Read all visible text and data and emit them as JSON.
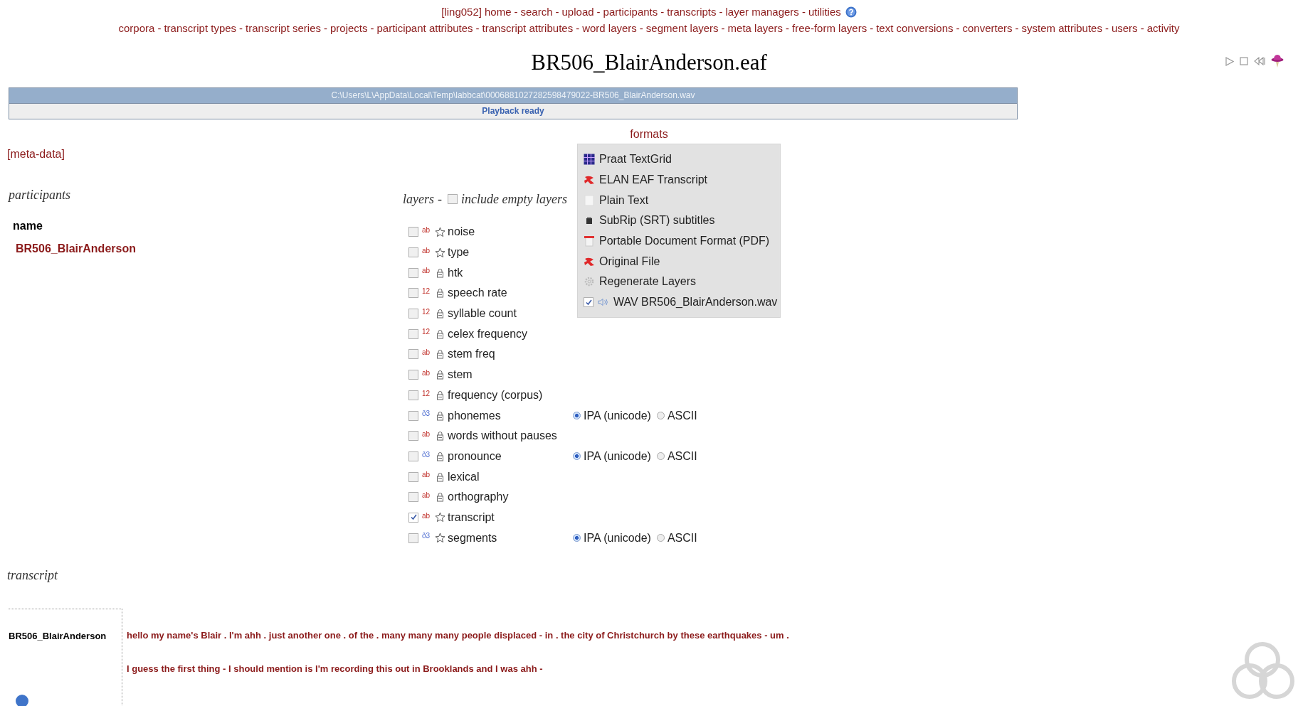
{
  "nav": {
    "user": "[ling052]",
    "separator": "-",
    "primary": [
      "home",
      "search",
      "upload",
      "participants",
      "transcripts",
      "layer managers",
      "utilities"
    ],
    "secondary": [
      "corpora",
      "transcript types",
      "transcript series",
      "projects",
      "participant attributes",
      "transcript attributes",
      "word layers",
      "segment layers",
      "meta layers",
      "free-form layers",
      "text conversions",
      "converters",
      "system attributes",
      "users",
      "activity"
    ]
  },
  "title": "BR506_BlairAnderson.eaf",
  "player": {
    "file": "C:\\Users\\L\\AppData\\Local\\Temp\\labbcat\\00068810272825984790​22-BR506_BlairAnderson.wav",
    "status": "Playback ready"
  },
  "formats": {
    "label": "formats",
    "items": [
      {
        "kind": "grid",
        "label": "Praat TextGrid"
      },
      {
        "kind": "elan",
        "label": "ELAN EAF Transcript"
      },
      {
        "kind": "blank",
        "label": "Plain Text"
      },
      {
        "kind": "srt",
        "label": "SubRip (SRT) subtitles"
      },
      {
        "kind": "pdf",
        "label": "Portable Document Format (PDF)"
      },
      {
        "kind": "elan",
        "label": "Original File"
      },
      {
        "kind": "gear",
        "label": "Regenerate Layers"
      },
      {
        "kind": "media",
        "label": "WAV BR506_BlairAnderson.wav",
        "checked": true
      }
    ]
  },
  "meta_data_link": "[meta-data]",
  "participants": {
    "heading": "participants",
    "column": "name",
    "rows": [
      "BR506_BlairAnderson"
    ]
  },
  "layers": {
    "heading": "layers",
    "separator": "-",
    "include_empty": {
      "label": "include empty layers",
      "checked": false
    },
    "items": [
      {
        "name": "noise",
        "type": "ab",
        "kind": "tree",
        "checked": false
      },
      {
        "name": "type",
        "type": "ab",
        "kind": "tree",
        "checked": false
      },
      {
        "name": "htk",
        "type": "ab",
        "kind": "lock",
        "checked": false
      },
      {
        "name": "speech rate",
        "type": "12",
        "kind": "lock",
        "checked": false
      },
      {
        "name": "syllable count",
        "type": "12",
        "kind": "lock",
        "checked": false
      },
      {
        "name": "celex frequency",
        "type": "12",
        "kind": "lock",
        "checked": false
      },
      {
        "name": "stem freq",
        "type": "ab",
        "kind": "lock",
        "checked": false
      },
      {
        "name": "stem",
        "type": "ab",
        "kind": "lock",
        "checked": false
      },
      {
        "name": "frequency (corpus)",
        "type": "12",
        "kind": "lock",
        "checked": false
      },
      {
        "name": "phonemes",
        "type": "ð3",
        "kind": "lock",
        "checked": false,
        "encodings": [
          {
            "label": "IPA (unicode)",
            "selected": true
          },
          {
            "label": "ASCII",
            "selected": false
          }
        ]
      },
      {
        "name": "words without pauses",
        "type": "ab",
        "kind": "lock",
        "checked": false
      },
      {
        "name": "pronounce",
        "type": "ð3",
        "kind": "lock",
        "checked": false,
        "encodings": [
          {
            "label": "IPA (unicode)",
            "selected": true
          },
          {
            "label": "ASCII",
            "selected": false
          }
        ]
      },
      {
        "name": "lexical",
        "type": "ab",
        "kind": "lock",
        "checked": false
      },
      {
        "name": "orthography",
        "type": "ab",
        "kind": "lock",
        "checked": false
      },
      {
        "name": "transcript",
        "type": "ab",
        "kind": "tree",
        "checked": true
      },
      {
        "name": "segments",
        "type": "ð3",
        "kind": "tree",
        "checked": false,
        "encodings": [
          {
            "label": "IPA (unicode)",
            "selected": true
          },
          {
            "label": "ASCII",
            "selected": false
          }
        ]
      }
    ]
  },
  "transcript": {
    "heading": "transcript",
    "speaker": "BR506_BlairAnderson",
    "lines": [
      "hello my name's Blair . I'm ahh . just another one . of the . many many many people displaced - in . the city of Christchurch by these earthquakes - um .",
      "I guess the first thing - I should mention is I'm recording this out in Brooklands and I was ahh -"
    ]
  }
}
